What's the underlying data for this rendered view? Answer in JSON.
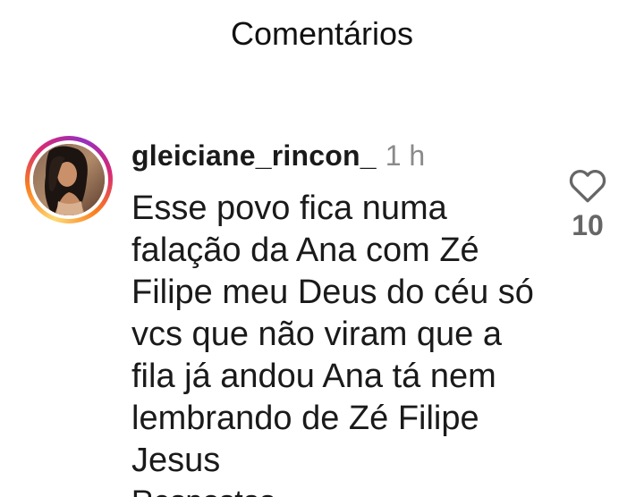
{
  "header": {
    "title": "Comentários"
  },
  "comment": {
    "username": "gleiciane_rincon_",
    "timestamp": "1 h",
    "text": "Esse povo fica numa falação da Ana com Zé Filipe meu Deus do céu só vcs que não viram que a fila já andou Ana tá nem lembrando de Zé Filipe Jesus",
    "like_count": "10",
    "avatar_icon": "user-photo",
    "like_icon": "heart-outline-icon"
  },
  "next_comment_cutoff": "Respostas",
  "colors": {
    "ring_gradient": [
      "#feda75",
      "#fa7e1e",
      "#d62976",
      "#962fbf"
    ],
    "timestamp": "#8a8a8a",
    "like_count": "#666666"
  }
}
